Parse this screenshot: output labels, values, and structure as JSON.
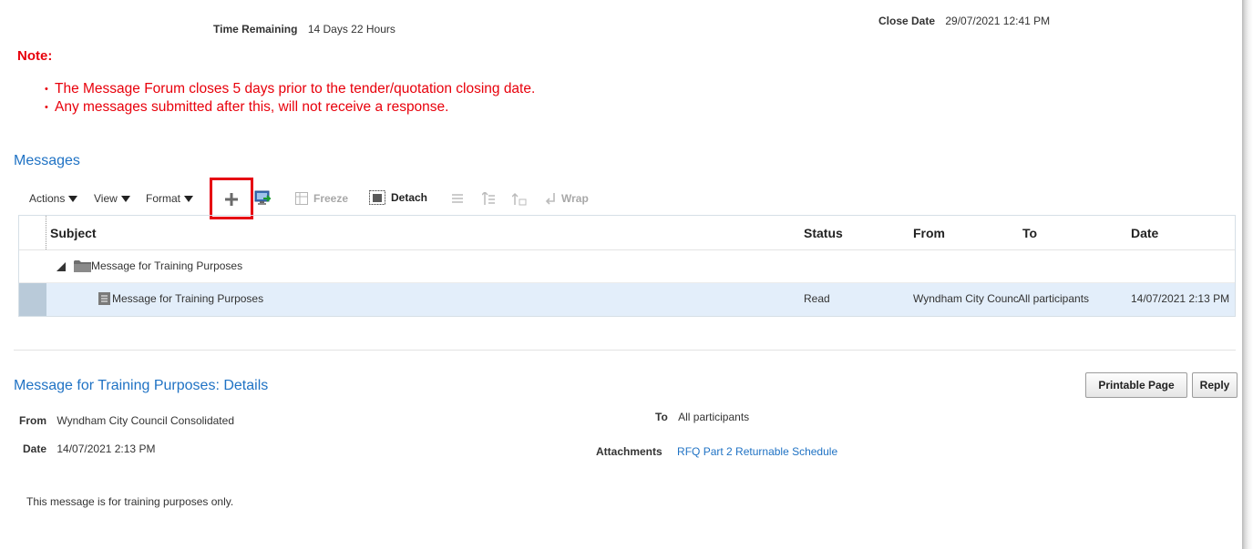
{
  "summary": {
    "time_remaining_label": "Time Remaining",
    "time_remaining_value": "14 Days 22 Hours",
    "close_date_label": "Close Date",
    "close_date_value": "29/07/2021 12:41 PM"
  },
  "note": {
    "title": "Note:",
    "items": [
      "The Message Forum closes 5 days prior to the tender/quotation closing date.",
      "Any messages submitted after this, will not receive a response."
    ]
  },
  "messages": {
    "title": "Messages",
    "toolbar": {
      "actions": "Actions",
      "view": "View",
      "format": "Format",
      "freeze": "Freeze",
      "detach": "Detach",
      "wrap": "Wrap"
    },
    "columns": {
      "subject": "Subject",
      "status": "Status",
      "from": "From",
      "to": "To",
      "date": "Date"
    },
    "rows": [
      {
        "subject": "Message for Training Purposes",
        "status": "",
        "from": "",
        "to": "",
        "date": "",
        "type": "folder"
      },
      {
        "subject": "Message for Training Purposes",
        "status": "Read",
        "from": "Wyndham City Council Consolidated",
        "to": "All participants",
        "date": "14/07/2021 2:13 PM",
        "type": "message"
      }
    ]
  },
  "details": {
    "title": "Message for Training Purposes: Details",
    "printable_button": "Printable Page",
    "reply_button": "Reply",
    "from_label": "From",
    "from_value": "Wyndham City Council Consolidated",
    "date_label": "Date",
    "date_value": "14/07/2021 2:13 PM",
    "to_label": "To",
    "to_value": "All participants",
    "attachments_label": "Attachments",
    "attachments_value": "RFQ Part 2 Returnable Schedule",
    "body": "This message is for training purposes only."
  },
  "colors": {
    "note_red": "#e8000b",
    "link_blue": "#1f72c4",
    "selected_row": "#e3eefa",
    "highlight_box": "#e60012"
  }
}
